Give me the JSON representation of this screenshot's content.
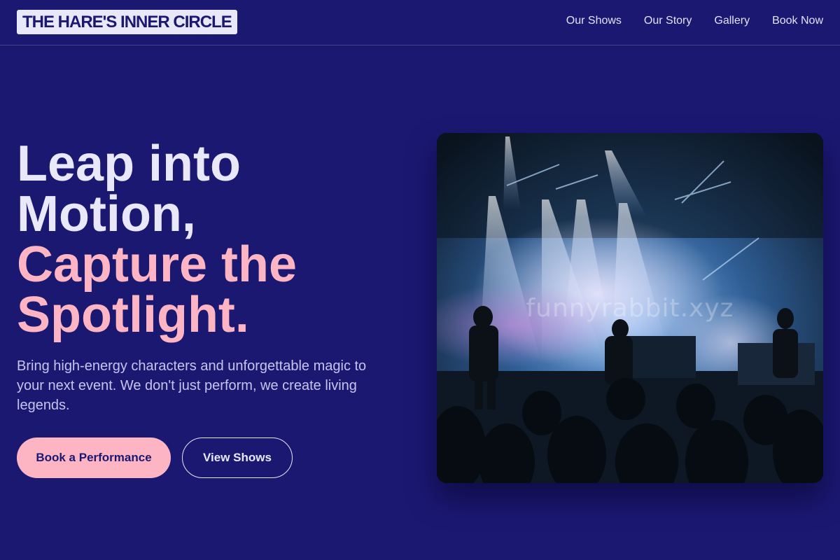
{
  "header": {
    "logo": "THE HARE'S INNER CIRCLE",
    "nav": [
      "Our Shows",
      "Our Story",
      "Gallery",
      "Book Now"
    ]
  },
  "hero": {
    "headline_line1": "Leap into",
    "headline_line2": "Motion,",
    "headline_accent_line1": "Capture the",
    "headline_accent_line2": "Spotlight.",
    "description": "Bring high-energy characters and unforgettable magic to your next event. We don't just perform, we create living legends.",
    "primary_button": "Book a Performance",
    "secondary_button": "View Shows",
    "image_watermark": "funnyrabbit.xyz"
  },
  "colors": {
    "background": "#1b1872",
    "accent_pink": "#fdb5c4",
    "text_light": "#e9e8fb"
  }
}
